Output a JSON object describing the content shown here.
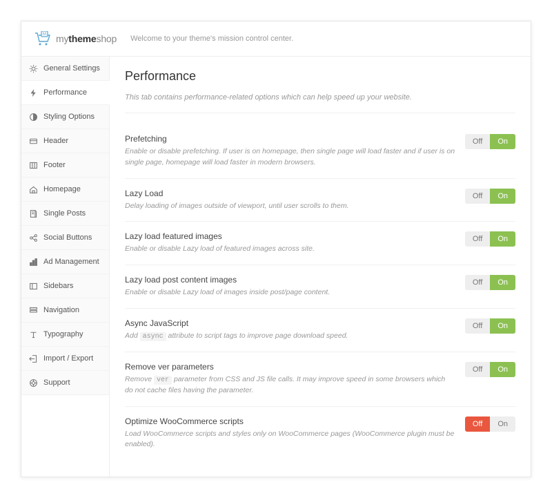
{
  "header": {
    "brand_my": "my",
    "brand_theme": "theme",
    "brand_shop": "shop",
    "tagline": "Welcome to your theme's mission control center."
  },
  "sidebar": {
    "items": [
      {
        "label": "General Settings",
        "icon": "gear"
      },
      {
        "label": "Performance",
        "icon": "bolt"
      },
      {
        "label": "Styling Options",
        "icon": "contrast"
      },
      {
        "label": "Header",
        "icon": "card"
      },
      {
        "label": "Footer",
        "icon": "columns"
      },
      {
        "label": "Homepage",
        "icon": "home"
      },
      {
        "label": "Single Posts",
        "icon": "doc"
      },
      {
        "label": "Social Buttons",
        "icon": "share"
      },
      {
        "label": "Ad Management",
        "icon": "bar"
      },
      {
        "label": "Sidebars",
        "icon": "sidebar"
      },
      {
        "label": "Navigation",
        "icon": "nav"
      },
      {
        "label": "Typography",
        "icon": "type"
      },
      {
        "label": "Import / Export",
        "icon": "exit"
      },
      {
        "label": "Support",
        "icon": "life"
      }
    ],
    "active_index": 1
  },
  "page": {
    "title": "Performance",
    "description": "This tab contains performance-related options which can help speed up your website."
  },
  "toggle_labels": {
    "off": "Off",
    "on": "On"
  },
  "options": [
    {
      "title": "Prefetching",
      "description": "Enable or disable prefetching. If user is on homepage, then single page will load faster and if user is on single page, homepage will load faster in modern browsers.",
      "state": "on"
    },
    {
      "title": "Lazy Load",
      "description": "Delay loading of images outside of viewport, until user scrolls to them.",
      "state": "on"
    },
    {
      "title": "Lazy load featured images",
      "description": "Enable or disable Lazy load of featured images across site.",
      "state": "on"
    },
    {
      "title": "Lazy load post content images",
      "description": "Enable or disable Lazy load of images inside post/page content.",
      "state": "on"
    },
    {
      "title": "Async JavaScript",
      "description": "Add `async` attribute to script tags to improve page download speed.",
      "state": "on"
    },
    {
      "title": "Remove ver parameters",
      "description": "Remove `ver` parameter from CSS and JS file calls. It may improve speed in some browsers which do not cache files having the parameter.",
      "state": "on"
    },
    {
      "title": "Optimize WooCommerce scripts",
      "description": "Load WooCommerce scripts and styles only on WooCommerce pages (WooCommerce plugin must be enabled).",
      "state": "off"
    }
  ]
}
